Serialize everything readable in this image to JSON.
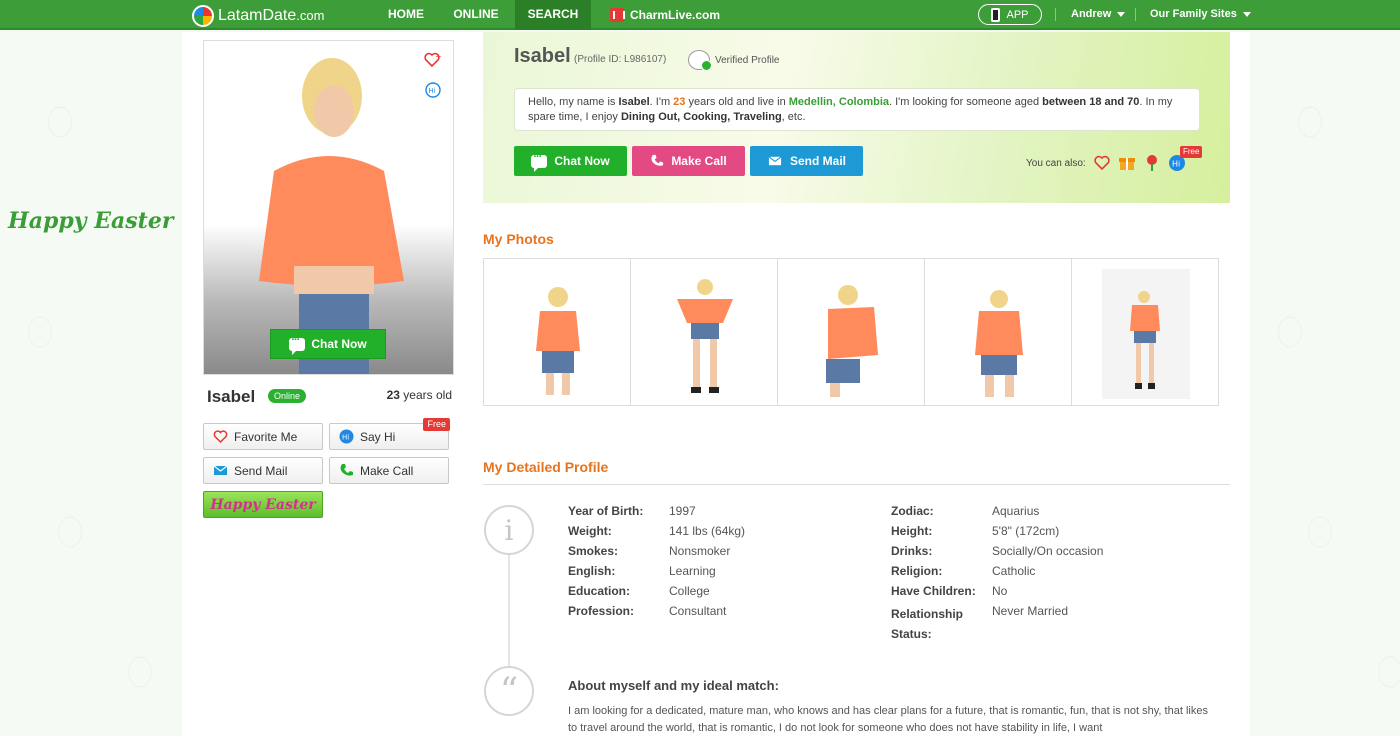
{
  "nav": {
    "logo_main": "LatamDate",
    "logo_suffix": ".com",
    "home": "HOME",
    "online": "ONLINE",
    "search": "SEARCH",
    "charm": "CharmLive.com",
    "app": "APP",
    "user": "Andrew",
    "family": "Our Family Sites"
  },
  "side": {
    "easter_text": "Happy Easter"
  },
  "left": {
    "chat_now": "Chat Now",
    "name": "Isabel",
    "online_badge": "Online",
    "age_num": "23",
    "age_suffix": " years old",
    "favorite": "Favorite Me",
    "say_hi": "Say Hi",
    "free": "Free",
    "send_mail": "Send Mail",
    "make_call": "Make Call",
    "easter_badge": "Happy Easter"
  },
  "profile": {
    "name": "Isabel",
    "profile_id": "(Profile ID: L986107)",
    "verified": "Verified Profile",
    "intro": {
      "p1": "Hello, my name is ",
      "name": "Isabel",
      "p2": ". I'm ",
      "age": "23",
      "p3": " years old and live in ",
      "city": "Medellin, Colombia",
      "p4": ". I'm looking for someone aged ",
      "range": "between 18 and 70",
      "p5": ". In my spare time, I enjoy ",
      "hobbies": "Dining Out, Cooking, Traveling",
      "p6": ", etc."
    },
    "chat_now": "Chat Now",
    "make_call": "Make Call",
    "send_mail": "Send Mail",
    "also": "You can also:",
    "free": "Free"
  },
  "photos": {
    "title": "My Photos",
    "count": 5
  },
  "details": {
    "title": "My Detailed Profile",
    "left": [
      {
        "label": "Year of Birth:",
        "value": "1997"
      },
      {
        "label": "Weight:",
        "value": "141 lbs (64kg)"
      },
      {
        "label": "Smokes:",
        "value": "Nonsmoker"
      },
      {
        "label": "English:",
        "value": "Learning"
      },
      {
        "label": "Education:",
        "value": "College"
      },
      {
        "label": "Profession:",
        "value": "Consultant"
      }
    ],
    "right": [
      {
        "label": "Zodiac:",
        "value": "Aquarius"
      },
      {
        "label": "Height:",
        "value": "5'8\" (172cm)"
      },
      {
        "label": "Drinks:",
        "value": "Socially/On occasion"
      },
      {
        "label": "Religion:",
        "value": "Catholic"
      },
      {
        "label": "Have Children:",
        "value": "No"
      },
      {
        "label": "Relationship Status:",
        "value": "Never Married"
      }
    ]
  },
  "about": {
    "title": "About myself and my ideal match:",
    "text": "I am looking for a dedicated, mature man, who knows and has clear plans for a future, that is romantic, fun, that is not shy, that likes to travel around the world, that is romantic, I do not look for someone who does not have stability in life, I want"
  },
  "colors": {
    "nav_green": "#3d9d38",
    "accent_orange": "#e8731e",
    "chat_green": "#22b02a",
    "call_pink": "#e34a84",
    "mail_blue": "#1d9ad6"
  }
}
